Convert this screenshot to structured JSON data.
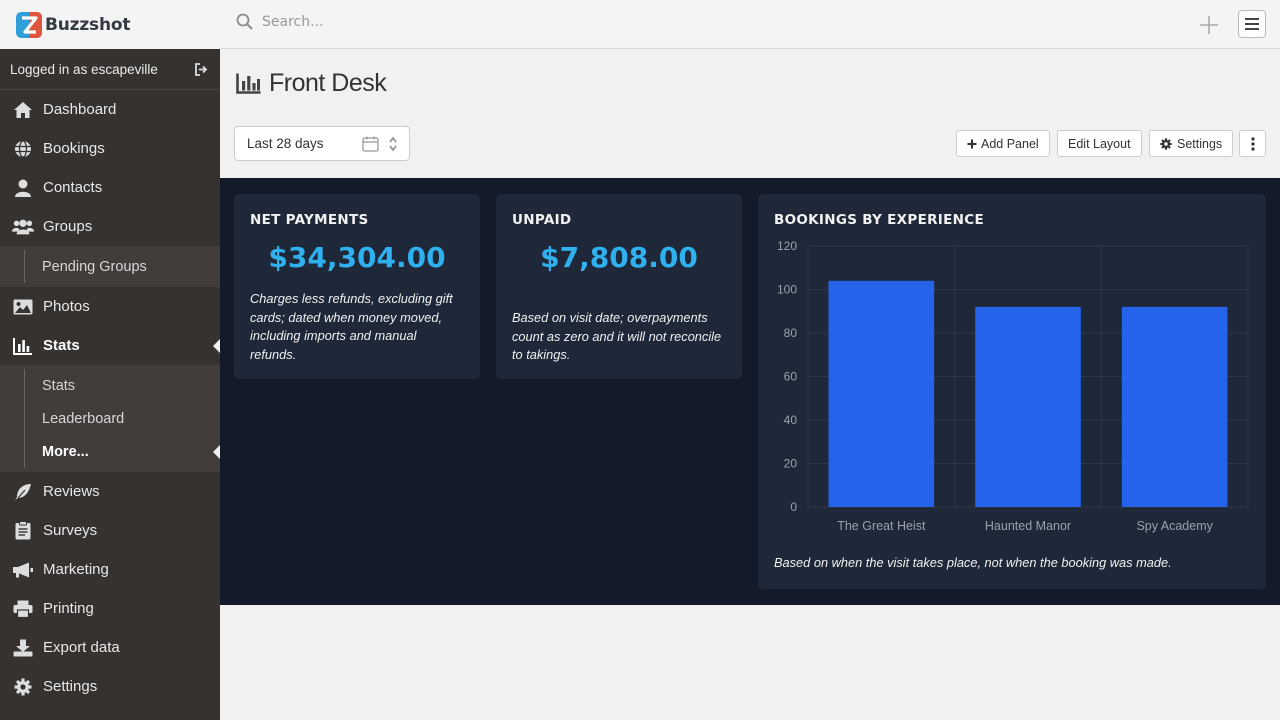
{
  "brand": {
    "name": "Buzzshot"
  },
  "search": {
    "placeholder": "Search..."
  },
  "sidebar": {
    "login_text": "Logged in as escapeville",
    "items": [
      {
        "label": "Dashboard"
      },
      {
        "label": "Bookings"
      },
      {
        "label": "Contacts"
      },
      {
        "label": "Groups"
      },
      {
        "label": "Pending Groups"
      },
      {
        "label": "Photos"
      },
      {
        "label": "Stats"
      },
      {
        "label": "Stats"
      },
      {
        "label": "Leaderboard"
      },
      {
        "label": "More..."
      },
      {
        "label": "Reviews"
      },
      {
        "label": "Surveys"
      },
      {
        "label": "Marketing"
      },
      {
        "label": "Printing"
      },
      {
        "label": "Export data"
      },
      {
        "label": "Settings"
      }
    ]
  },
  "page": {
    "title": "Front Desk"
  },
  "toolbar": {
    "range_value": "Last 28 days",
    "add_panel": "Add Panel",
    "edit_layout": "Edit Layout",
    "settings": "Settings"
  },
  "panels": {
    "net_payments": {
      "title": "NET PAYMENTS",
      "value": "$34,304.00",
      "note": "Charges less refunds, excluding gift cards; dated when money moved, including imports and manual refunds."
    },
    "unpaid": {
      "title": "UNPAID",
      "value": "$7,808.00",
      "note": "Based on visit date; overpayments count as zero and it will not reconcile to takings."
    },
    "bookings_by_experience": {
      "title": "BOOKINGS BY EXPERIENCE",
      "note": "Based on when the visit takes place, not when the booking was made."
    }
  },
  "colors": {
    "bar": "#2563eb",
    "metric": "#2fb0ef",
    "dashboard_bg": "#131a29",
    "panel_bg": "#1e2838",
    "sidebar_bg": "#363230"
  },
  "chart_data": {
    "type": "bar",
    "title": "BOOKINGS BY EXPERIENCE",
    "categories": [
      "The Great Heist",
      "Haunted Manor",
      "Spy Academy"
    ],
    "values": [
      104,
      92,
      92
    ],
    "ylim": [
      0,
      120
    ],
    "yticks": [
      "0",
      "20",
      "40",
      "60",
      "80",
      "100",
      "120"
    ],
    "grid": true
  }
}
